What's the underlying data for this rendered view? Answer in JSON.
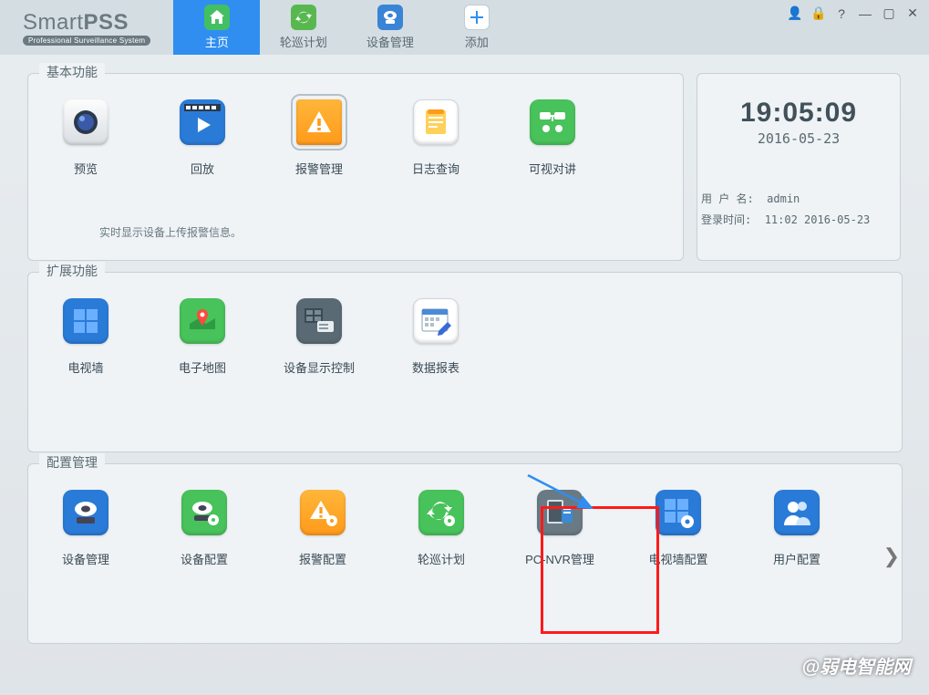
{
  "app": {
    "title_a": "Smart",
    "title_b": "PSS",
    "subtitle": "Professional Surveillance System"
  },
  "tabs": {
    "home": {
      "label": "主页"
    },
    "patrol": {
      "label": "轮巡计划"
    },
    "device": {
      "label": "设备管理"
    },
    "add": {
      "label": "添加"
    }
  },
  "clock": {
    "time": "19:05:09",
    "date": "2016-05-23",
    "user_label": "用 户 名:",
    "user_value": "admin",
    "login_label": "登录时间:",
    "login_value": "11:02 2016-05-23"
  },
  "section": {
    "basic": "基本功能",
    "ext": "扩展功能",
    "cfg": "配置管理"
  },
  "basic": {
    "preview": "预览",
    "playback": "回放",
    "alarm": "报警管理",
    "log": "日志查询",
    "intercom": "可视对讲",
    "hint": "实时显示设备上传报警信息。"
  },
  "ext": {
    "tvwall": "电视墙",
    "emap": "电子地图",
    "devdisp": "设备显示控制",
    "report": "数据报表"
  },
  "cfg": {
    "devmgr": "设备管理",
    "devcfg": "设备配置",
    "alarmcfg": "报警配置",
    "patrol": "轮巡计划",
    "pcnvr": "PC-NVR管理",
    "tvwallcfg": "电视墙配置",
    "usercfg": "用户配置"
  },
  "watermark": "@弱电智能网"
}
